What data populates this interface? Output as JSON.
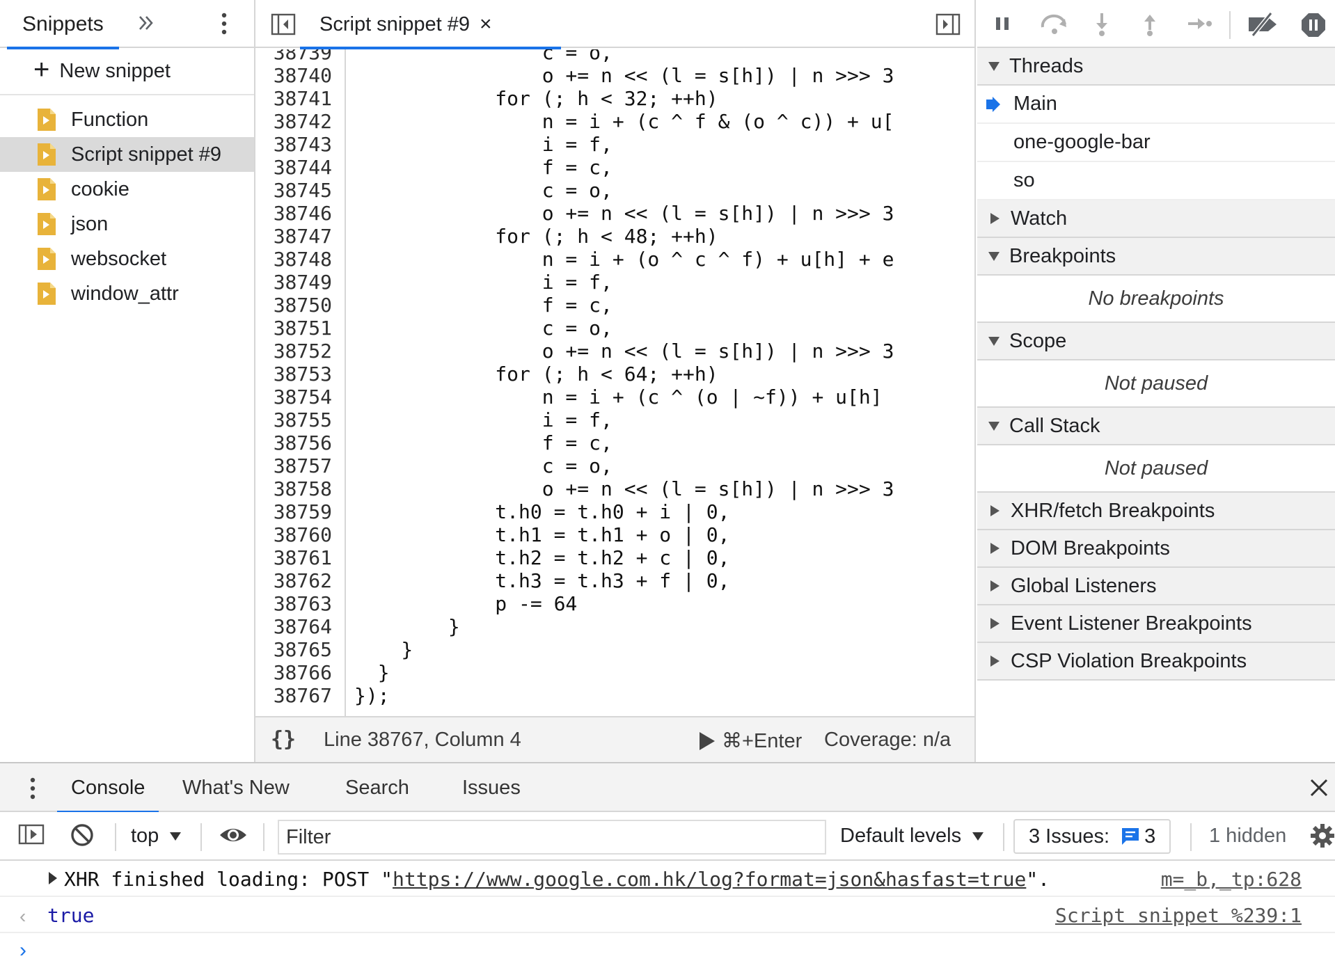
{
  "navigator": {
    "tab_label": "Snippets",
    "more_tabs_icon": "double-chevron-right-icon",
    "menu_icon": "vertical-dots-icon",
    "new_snippet_label": "New snippet",
    "snippets": [
      {
        "name": "Function",
        "selected": false
      },
      {
        "name": "Script snippet #9",
        "selected": true
      },
      {
        "name": "cookie",
        "selected": false
      },
      {
        "name": "json",
        "selected": false
      },
      {
        "name": "websocket",
        "selected": false
      },
      {
        "name": "window_attr",
        "selected": false
      }
    ],
    "file_icon_color": "#e8b33a"
  },
  "editor": {
    "tab_label": "Script snippet #9",
    "tab_close": "×",
    "line_numbers": [
      "38739",
      "38740",
      "38741",
      "38742",
      "38743",
      "38744",
      "38745",
      "38746",
      "38747",
      "38748",
      "38749",
      "38750",
      "38751",
      "38752",
      "38753",
      "38754",
      "38755",
      "38756",
      "38757",
      "38758",
      "38759",
      "38760",
      "38761",
      "38762",
      "38763",
      "38764",
      "38765",
      "38766",
      "38767"
    ],
    "code_lines": [
      "                c = o,",
      "                o += n << (l = s[h]) | n >>> 3",
      "            for (; h < 32; ++h)",
      "                n = i + (c ^ f & (o ^ c)) + u[",
      "                i = f,",
      "                f = c,",
      "                c = o,",
      "                o += n << (l = s[h]) | n >>> 3",
      "            for (; h < 48; ++h)",
      "                n = i + (o ^ c ^ f) + u[h] + e",
      "                i = f,",
      "                f = c,",
      "                c = o,",
      "                o += n << (l = s[h]) | n >>> 3",
      "            for (; h < 64; ++h)",
      "                n = i + (c ^ (o | ~f)) + u[h]",
      "                i = f,",
      "                f = c,",
      "                c = o,",
      "                o += n << (l = s[h]) | n >>> 3",
      "            t.h0 = t.h0 + i | 0,",
      "            t.h1 = t.h1 + o | 0,",
      "            t.h2 = t.h2 + c | 0,",
      "            t.h3 = t.h3 + f | 0,",
      "            p -= 64",
      "        }",
      "    }",
      "  }",
      "});"
    ],
    "footer": {
      "pretty_print": "{}",
      "cursor_position": "Line 38767, Column 4",
      "run_shortcut": "⌘+Enter",
      "coverage": "Coverage: n/a"
    }
  },
  "debugger": {
    "toolbar_icons": [
      "pause-icon",
      "step-over-icon",
      "step-into-icon",
      "step-out-icon",
      "step-icon",
      "deactivate-breakpoints-icon",
      "pause-on-exceptions-icon"
    ],
    "threads_title": "Threads",
    "threads": [
      "Main",
      "one-google-bar",
      "so"
    ],
    "watch_title": "Watch",
    "breakpoints_title": "Breakpoints",
    "breakpoints_empty": "No breakpoints",
    "scope_title": "Scope",
    "scope_empty": "Not paused",
    "callstack_title": "Call Stack",
    "callstack_empty": "Not paused",
    "collapsed_sections": [
      "XHR/fetch Breakpoints",
      "DOM Breakpoints",
      "Global Listeners",
      "Event Listener Breakpoints",
      "CSP Violation Breakpoints"
    ],
    "accent_color": "#1a73e8"
  },
  "drawer": {
    "tabs": [
      "Console",
      "What's New",
      "Search",
      "Issues"
    ],
    "active_tab": "Console",
    "close_label": "×",
    "console_toolbar": {
      "context": "top",
      "filter_placeholder": "Filter",
      "levels": "Default levels",
      "issues_label": "3 Issues:",
      "issues_count": "3",
      "hidden": "1 hidden"
    },
    "messages": [
      {
        "prefix": "XHR finished loading: POST \"",
        "url": "https://www.google.com.hk/log?format=json&hasfast=true",
        "suffix": "\".",
        "source": "m=_b,_tp:628"
      },
      {
        "result": "true",
        "source": "Script snippet %239:1"
      }
    ],
    "prompt": "›"
  }
}
